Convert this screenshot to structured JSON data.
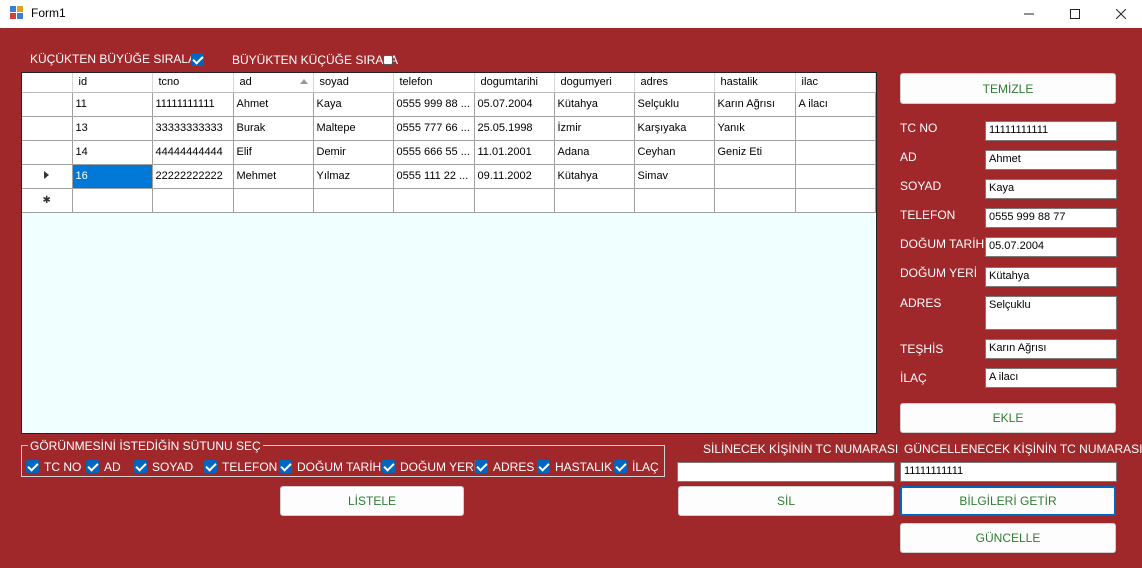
{
  "window": {
    "title": "Form1"
  },
  "sort": {
    "asc_label": "KÜÇÜKTEN BÜYÜĞE SIRALA",
    "asc_checked": true,
    "desc_label": "BÜYÜKTEN KÜÇÜĞE SIRALA",
    "desc_checked": false
  },
  "grid": {
    "columns": [
      "id",
      "tcno",
      "ad",
      "soyad",
      "telefon",
      "dogumtarihi",
      "dogumyeri",
      "adres",
      "hastalik",
      "ilac"
    ],
    "sorted_column": "ad",
    "rows": [
      [
        "11",
        "11111111111",
        "Ahmet",
        "Kaya",
        "0555 999 88 ...",
        "05.07.2004",
        "Kütahya",
        "Selçuklu",
        "Karın Ağrısı",
        "A ilacı"
      ],
      [
        "13",
        "33333333333",
        "Burak",
        "Maltepe",
        "0555 777 66 ...",
        "25.05.1998",
        "İzmir",
        "Karşıyaka",
        "Yanık",
        ""
      ],
      [
        "14",
        "44444444444",
        "Elif",
        "Demir",
        "0555 666 55 ...",
        "11.01.2001",
        "Adana",
        "Ceyhan",
        "Geniz Eti",
        ""
      ],
      [
        "16",
        "22222222222",
        "Mehmet",
        "Yılmaz",
        "0555 111 22 ...",
        "09.11.2002",
        "Kütahya",
        "Simav",
        "",
        ""
      ]
    ],
    "current_row": 3,
    "selected_cell": [
      3,
      0
    ]
  },
  "columns_group": {
    "title": "GÖRÜNMESİNİ İSTEDİĞİN SÜTUNU SEÇ",
    "items": [
      {
        "label": "TC NO",
        "checked": true
      },
      {
        "label": "AD",
        "checked": true
      },
      {
        "label": "SOYAD",
        "checked": true
      },
      {
        "label": "TELEFON",
        "checked": true
      },
      {
        "label": "DOĞUM TARİHİ",
        "checked": true
      },
      {
        "label": "DOĞUM YERİ",
        "checked": true
      },
      {
        "label": "ADRES",
        "checked": true
      },
      {
        "label": "HASTALIK",
        "checked": true
      },
      {
        "label": "İLAÇ",
        "checked": true
      }
    ]
  },
  "buttons": {
    "listele": "LİSTELE",
    "temizle": "TEMİZLE",
    "ekle": "EKLE",
    "sil": "SİL",
    "bilgileri_getir": "BİLGİLERİ GETİR",
    "guncelle": "GÜNCELLE"
  },
  "form": {
    "tc_label": "TC NO",
    "tc_value": "11111111111",
    "ad_label": "AD",
    "ad_value": "Ahmet",
    "soyad_label": "SOYAD",
    "soyad_value": "Kaya",
    "telefon_label": "TELEFON",
    "telefon_value": "0555 999 88 77",
    "dogum_tarihi_label": "DOĞUM TARİHİ",
    "dogum_tarihi_value": "05.07.2004",
    "dogum_yeri_label": "DOĞUM YERİ",
    "dogum_yeri_value": "Kütahya",
    "adres_label": "ADRES",
    "adres_value": "Selçuklu",
    "teshis_label": "TEŞHİS",
    "teshis_value": "Karın Ağrısı",
    "ilac_label": "İLAÇ",
    "ilac_value": "A ilacı"
  },
  "delete": {
    "label": "SİLİNECEK KİŞİNİN TC NUMARASI",
    "value": ""
  },
  "update": {
    "label": "GÜNCELLENECEK KİŞİNİN TC NUMARASI",
    "value": "11111111111"
  },
  "colors": {
    "background": "#a0282b",
    "selection": "#0078d7",
    "grid_bg": "#f0ffff",
    "button_text": "#2e7d32"
  }
}
